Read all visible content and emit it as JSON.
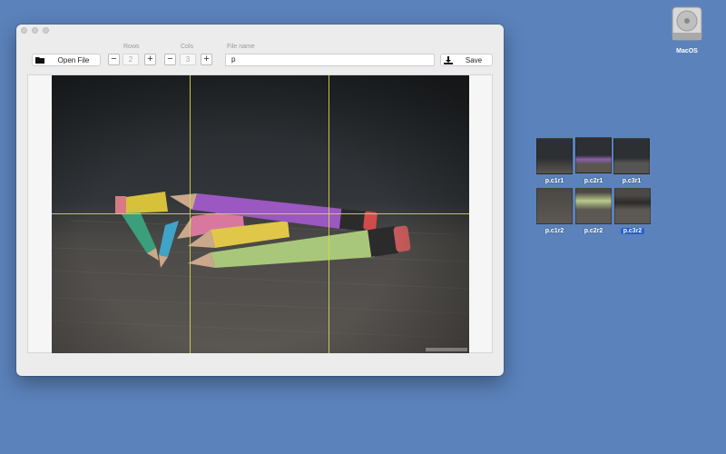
{
  "toolbar": {
    "open_file_label": "Open File",
    "rows_label": "Rows",
    "rows_value": "2",
    "cols_label": "Cols",
    "cols_value": "3",
    "file_name_label": "File name",
    "file_name_value": "p",
    "save_label": "Save",
    "decrement_symbol": "−",
    "increment_symbol": "+"
  },
  "desktop": {
    "disk_label": "MacOS",
    "tiles": [
      {
        "label": "p.c1r1",
        "selected": false
      },
      {
        "label": "p.c2r1",
        "selected": false
      },
      {
        "label": "p.c3r1",
        "selected": false
      },
      {
        "label": "p.c1r2",
        "selected": false
      },
      {
        "label": "p.c2r2",
        "selected": false
      },
      {
        "label": "p.c3r2",
        "selected": true
      }
    ]
  },
  "colors": {
    "desktop": "#5b82bb",
    "grid_line": "#d6d64d",
    "selection": "#2a62d9"
  }
}
